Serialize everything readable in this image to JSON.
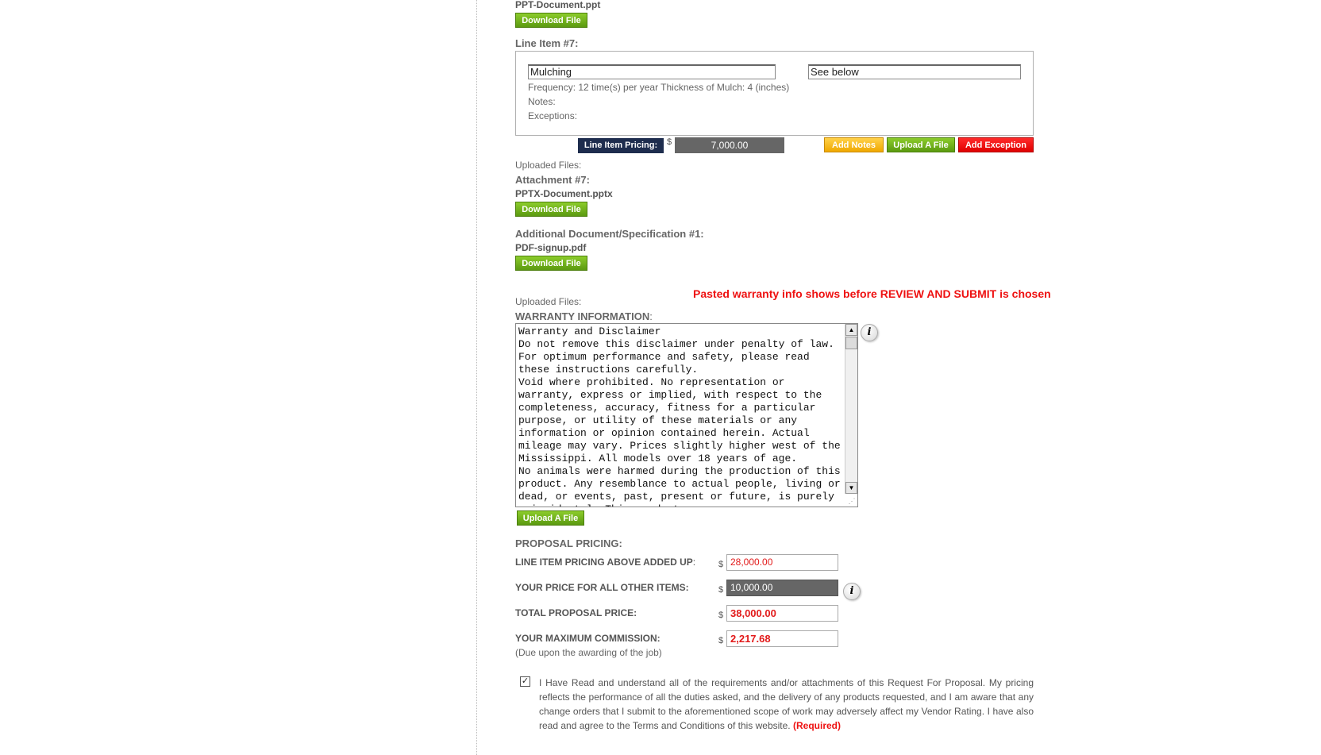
{
  "top_file": {
    "filename": "PPT-Document.ppt",
    "download_label": "Download File"
  },
  "line_item": {
    "heading": "Line Item #7:",
    "name_value": "Mulching",
    "description_value": "See below",
    "frequency": "Frequency: 12 time(s) per year Thickness of Mulch: 4 (inches)",
    "notes": "Notes:",
    "exceptions": "Exceptions:",
    "pricing_label": "Line Item Pricing:",
    "currency": "$",
    "price": "7,000.00",
    "add_notes": "Add Notes",
    "upload_file": "Upload A File",
    "add_exception": "Add Exception",
    "uploaded_files": "Uploaded Files:"
  },
  "attachment": {
    "heading": "Attachment #7:",
    "filename": "PPTX-Document.pptx",
    "download_label": "Download File"
  },
  "additional_doc": {
    "heading": "Additional Document/Specification #1:",
    "filename": "PDF-signup.pdf",
    "download_label": "Download File"
  },
  "annotation": "Pasted warranty info shows before REVIEW AND SUBMIT is chosen",
  "warranty": {
    "uploaded_files": "Uploaded Files:",
    "heading": "WARRANTY INFORMATION",
    "heading_suffix": ":",
    "text": "Warranty and Disclaimer\nDo not remove this disclaimer under penalty of law.\nFor optimum performance and safety, please read these instructions carefully.\nVoid where prohibited. No representation or warranty, express or implied, with respect to the completeness, accuracy, fitness for a particular purpose, or utility of these materials or any information or opinion contained herein. Actual mileage may vary. Prices slightly higher west of the Mississippi. All models over 18 years of age.\nNo animals were harmed during the production of this product. Any resemblance to actual people, living or dead, or events, past, present or future, is purely coincidental. This product",
    "info_icon": "i",
    "upload_label": "Upload A File"
  },
  "proposal": {
    "heading": "PROPOSAL PRICING:",
    "currency": "$",
    "rows": [
      {
        "label": "LINE ITEM PRICING ABOVE ADDED UP",
        "suffix": ":",
        "value": "28,000.00"
      },
      {
        "label": "YOUR PRICE FOR ALL OTHER ITEMS:",
        "suffix": "",
        "value": "10,000.00"
      },
      {
        "label": "TOTAL PROPOSAL PRICE:",
        "suffix": "",
        "value": "38,000.00"
      },
      {
        "label": "YOUR MAXIMUM COMMISSION:",
        "suffix": "",
        "value": "2,217.68"
      }
    ],
    "commission_note": "(Due upon the awarding of the job)",
    "info_icon": "i"
  },
  "agreement": {
    "checked": true,
    "checkmark": "✓",
    "text": "I Have Read and understand all of the requirements and/or attachments of this Request For Proposal. My pricing reflects the performance of all the duties asked, and the delivery of any products requested, and I am aware that any change orders that I submit to the aforementioned scope of work may adversely affect my Vendor Rating. I have also read and agree to the Terms and Conditions of this website.",
    "required": "(Required)"
  },
  "colors": {
    "green_button": "#5b9a10",
    "orange_button": "#f0a800",
    "red_button": "#e00000",
    "navy_label": "#1e2d4e",
    "warning_red": "#ee1111"
  }
}
